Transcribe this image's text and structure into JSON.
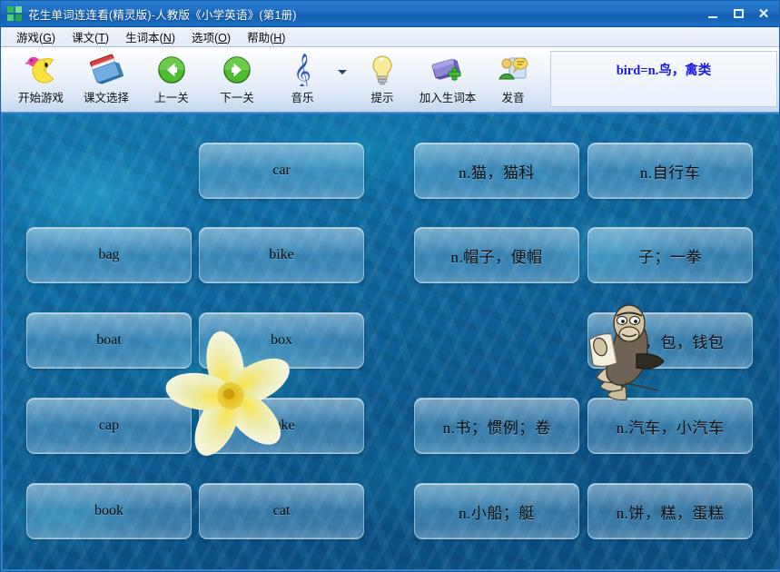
{
  "window": {
    "title": "花生单词连连看(精灵版)-人教版《小学英语》(第1册)",
    "app_icon": "four-squares-icon",
    "controls": {
      "minimize": "minimize-icon",
      "maximize": "maximize-icon",
      "close": "close-icon"
    }
  },
  "menubar": {
    "items": [
      {
        "label": "游戏(G)",
        "text": "游戏",
        "accel": "G"
      },
      {
        "label": "课文(T)",
        "text": "课文",
        "accel": "T"
      },
      {
        "label": "生词本(N)",
        "text": "生词本",
        "accel": "N"
      },
      {
        "label": "选项(O)",
        "text": "选项",
        "accel": "O"
      },
      {
        "label": "帮助(H)",
        "text": "帮助",
        "accel": "H"
      }
    ]
  },
  "toolbar": {
    "buttons": [
      {
        "label": "开始游戏",
        "icon": "pacman-start-game-icon"
      },
      {
        "label": "课文选择",
        "icon": "books-lesson-select-icon"
      },
      {
        "label": "上一关",
        "icon": "green-arrow-left-icon"
      },
      {
        "label": "下一关",
        "icon": "green-arrow-right-icon"
      },
      {
        "label": "音乐",
        "icon": "music-note-icon"
      },
      {
        "label": "提示",
        "icon": "lightbulb-hint-icon"
      },
      {
        "label": "加入生词本",
        "icon": "book-plus-add-icon"
      },
      {
        "label": "发音",
        "icon": "person-speaker-pronounce-icon"
      }
    ],
    "music_dropdown_icon": "chevron-down-icon",
    "status_text": "bird=n.鸟，禽类",
    "status_color": "#1919e0"
  },
  "board": {
    "columns": 4,
    "rows": 5,
    "tiles": [
      {
        "id": "c2r1",
        "text": "car",
        "lang": "en",
        "col": 2,
        "row": 1
      },
      {
        "id": "c3r1",
        "text": "n.猫，猫科",
        "lang": "cn",
        "col": 3,
        "row": 1
      },
      {
        "id": "c4r1",
        "text": "n.自行车",
        "lang": "cn",
        "col": 4,
        "row": 1
      },
      {
        "id": "c1r2",
        "text": "bag",
        "lang": "en",
        "col": 1,
        "row": 2
      },
      {
        "id": "c2r2",
        "text": "bike",
        "lang": "en",
        "col": 2,
        "row": 2
      },
      {
        "id": "c3r2",
        "text": "n.帽子，便帽",
        "lang": "cn",
        "col": 3,
        "row": 2
      },
      {
        "id": "c4r2",
        "text": "子；一拳",
        "lang": "cn",
        "col": 4,
        "row": 2
      },
      {
        "id": "c1r3",
        "text": "boat",
        "lang": "en",
        "col": 1,
        "row": 3
      },
      {
        "id": "c2r3",
        "text": "box",
        "lang": "en",
        "col": 2,
        "row": 3
      },
      {
        "id": "c4r3",
        "text": "n.袋，包，钱包",
        "lang": "cn",
        "col": 4,
        "row": 3
      },
      {
        "id": "c1r4",
        "text": "cap",
        "lang": "en",
        "col": 1,
        "row": 4
      },
      {
        "id": "c2r4",
        "text": "cake",
        "lang": "en",
        "col": 2,
        "row": 4
      },
      {
        "id": "c3r4",
        "text": "n.书；惯例；卷",
        "lang": "cn",
        "col": 3,
        "row": 4
      },
      {
        "id": "c4r4",
        "text": "n.汽车，小汽车",
        "lang": "cn",
        "col": 4,
        "row": 4
      },
      {
        "id": "c1r5",
        "text": "book",
        "lang": "en",
        "col": 1,
        "row": 5
      },
      {
        "id": "c2r5",
        "text": "cat",
        "lang": "en",
        "col": 2,
        "row": 5
      },
      {
        "id": "c3r5",
        "text": "n.小船；艇",
        "lang": "cn",
        "col": 3,
        "row": 5
      },
      {
        "id": "c4r5",
        "text": "n.饼，糕，蛋糕",
        "lang": "cn",
        "col": 4,
        "row": 5
      }
    ],
    "decorations": [
      {
        "name": "flower-decoration",
        "icon": "frangipani-flower-icon"
      },
      {
        "name": "mascot-character",
        "icon": "walrus-reading-paper-icon"
      }
    ]
  },
  "colors": {
    "titlebar": "#1d64b5",
    "menubar": "#e9f0f9",
    "toolbar": "#e3edf9",
    "board_water": "#0d5f95",
    "tile_fill": "#bcdcf2",
    "accent_text": "#1919e0"
  }
}
